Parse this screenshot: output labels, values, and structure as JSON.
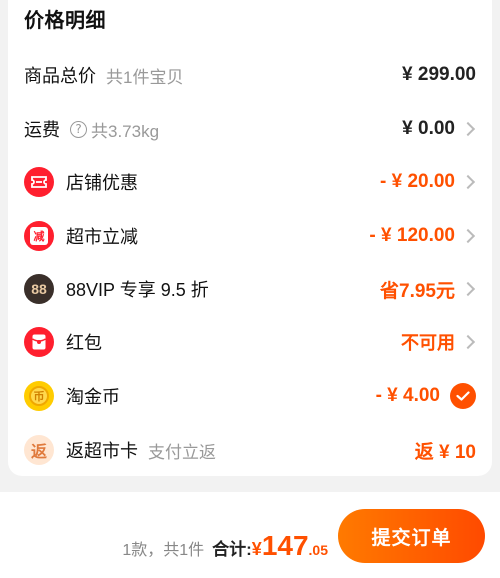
{
  "section_title": "价格明细",
  "rows": {
    "goods_total": {
      "label": "商品总价",
      "sub": "共1件宝贝",
      "value": "¥ 299.00"
    },
    "shipping": {
      "label": "运费",
      "help": "?",
      "sub": "共3.73kg",
      "value": "¥ 0.00"
    },
    "shop_discount": {
      "label": "店铺优惠",
      "value": "- ¥ 20.00"
    },
    "supermarket_discount": {
      "label": "超市立减",
      "icon_text": "减",
      "value": "- ¥ 120.00"
    },
    "vip": {
      "label": "88VIP 专享 9.5 折",
      "icon_text": "88",
      "value": "省7.95元"
    },
    "red_packet": {
      "label": "红包",
      "value": "不可用"
    },
    "taojinbi": {
      "label": "淘金币",
      "icon_text": "币",
      "value": "- ¥ 4.00"
    },
    "cashback_card": {
      "label": "返超市卡",
      "icon_text": "返",
      "sub": "支付立返",
      "value": "返 ¥ 10"
    }
  },
  "footer": {
    "count": "1款，共1件",
    "total_label": "合计:",
    "currency": "¥",
    "total_int": "147",
    "total_dec": ".05",
    "submit_label": "提交订单"
  },
  "colors": {
    "accent": "#ff5000",
    "icon_red": "#ff1f2e",
    "gold": "#ffcc00"
  },
  "icons": [
    "shop-coupon-icon",
    "supermarket-discount-icon",
    "vip-88-icon",
    "red-packet-icon",
    "taojinbi-coin-icon",
    "cashback-icon",
    "chevron-right-icon",
    "check-icon",
    "help-icon"
  ]
}
